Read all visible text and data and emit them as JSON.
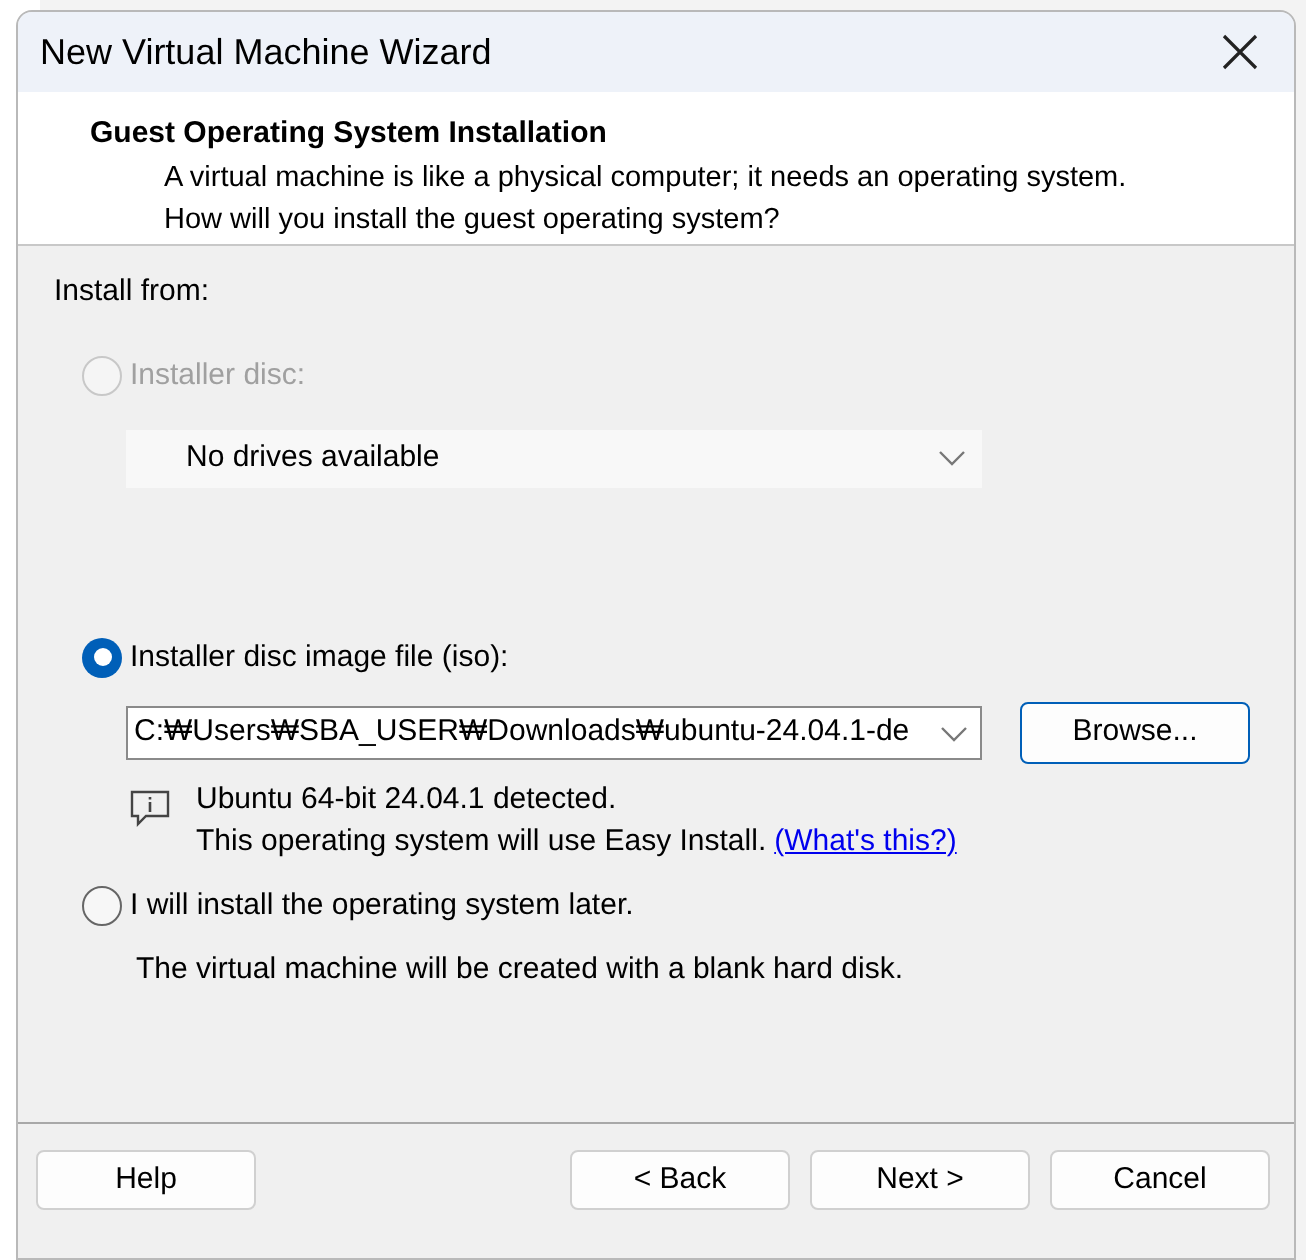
{
  "window": {
    "title": "New Virtual Machine Wizard"
  },
  "header": {
    "title": "Guest Operating System Installation",
    "description": "A virtual machine is like a physical computer; it needs an operating system. How will you install the guest operating system?"
  },
  "install_from_label": "Install from:",
  "options": [
    {
      "kind": "disc",
      "label": "Installer disc:",
      "selected": false,
      "disabled": true,
      "dropdown": {
        "value": "No drives available",
        "disabled": true
      }
    },
    {
      "kind": "iso",
      "label": "Installer disc image file (iso):",
      "selected": true,
      "disabled": false,
      "path": "C:₩Users₩SBA_USER₩Downloads₩ubuntu-24.04.1-de",
      "browse": "Browse...",
      "detected": "Ubuntu 64-bit 24.04.1 detected.",
      "easy_install": "This operating system will use Easy Install.",
      "link": "(What's this?)"
    },
    {
      "kind": "later",
      "label": "I will install the operating system later.",
      "selected": false,
      "disabled": false,
      "note": "The virtual machine will be created with a blank hard disk."
    }
  ],
  "buttons": [
    {
      "label": "Help",
      "kind": "help"
    },
    {
      "label": "< Back",
      "kind": "nav"
    },
    {
      "label": "Next >",
      "kind": "nav"
    },
    {
      "label": "Cancel",
      "kind": "nav"
    }
  ]
}
